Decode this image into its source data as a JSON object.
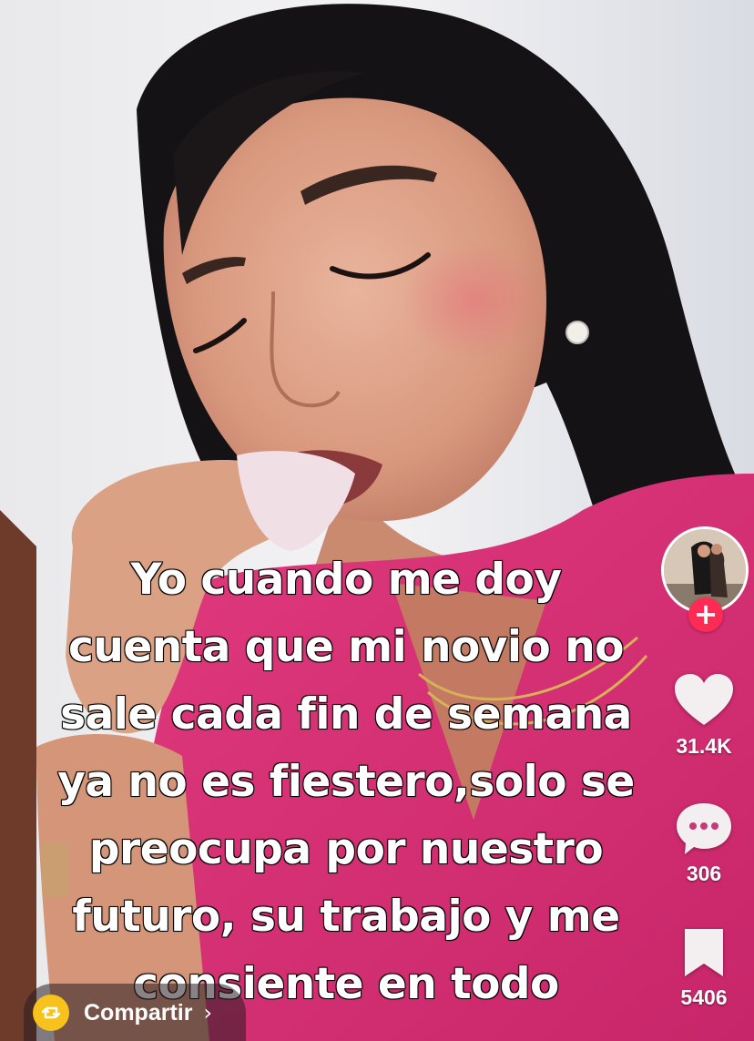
{
  "video": {
    "caption_lines": [
      "Yo cuando me doy",
      "cuenta que mi novio no",
      "sale cada fin de semana",
      "ya no es fiestero,solo se",
      "preocupa por nuestro",
      "futuro, su trabajo y me",
      "consiente en todo"
    ]
  },
  "actions": {
    "follow_symbol": "+",
    "like_count": "31.4K",
    "comment_count": "306",
    "save_count": "5406"
  },
  "share": {
    "label": "Compartir",
    "chevron": "›"
  },
  "icons": {
    "like": "heart-icon",
    "comment": "comment-bubble-icon",
    "save": "bookmark-icon",
    "share": "share-repost-icon"
  },
  "colors": {
    "follow_badge": "#fe2c55",
    "share_badge": "#f7c21b",
    "text": "#ffffff"
  }
}
